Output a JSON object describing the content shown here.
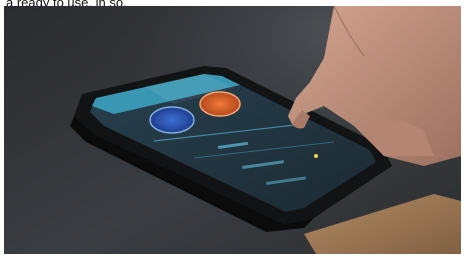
{
  "caption": {
    "partial_text": "a ready to use, in so,"
  },
  "photo": {
    "subject": "phone-on-table",
    "colors": {
      "table": "#2f3134",
      "table_highlight": "#4a4d52",
      "phone_body": "#141516",
      "screen_bg": "#2a3e4b",
      "screen_header": "#3a97b3",
      "gauge_blue": "#2a56b8",
      "gauge_orange": "#e0632b",
      "leather_case": "#9c7957",
      "skin": "#c49782"
    }
  }
}
